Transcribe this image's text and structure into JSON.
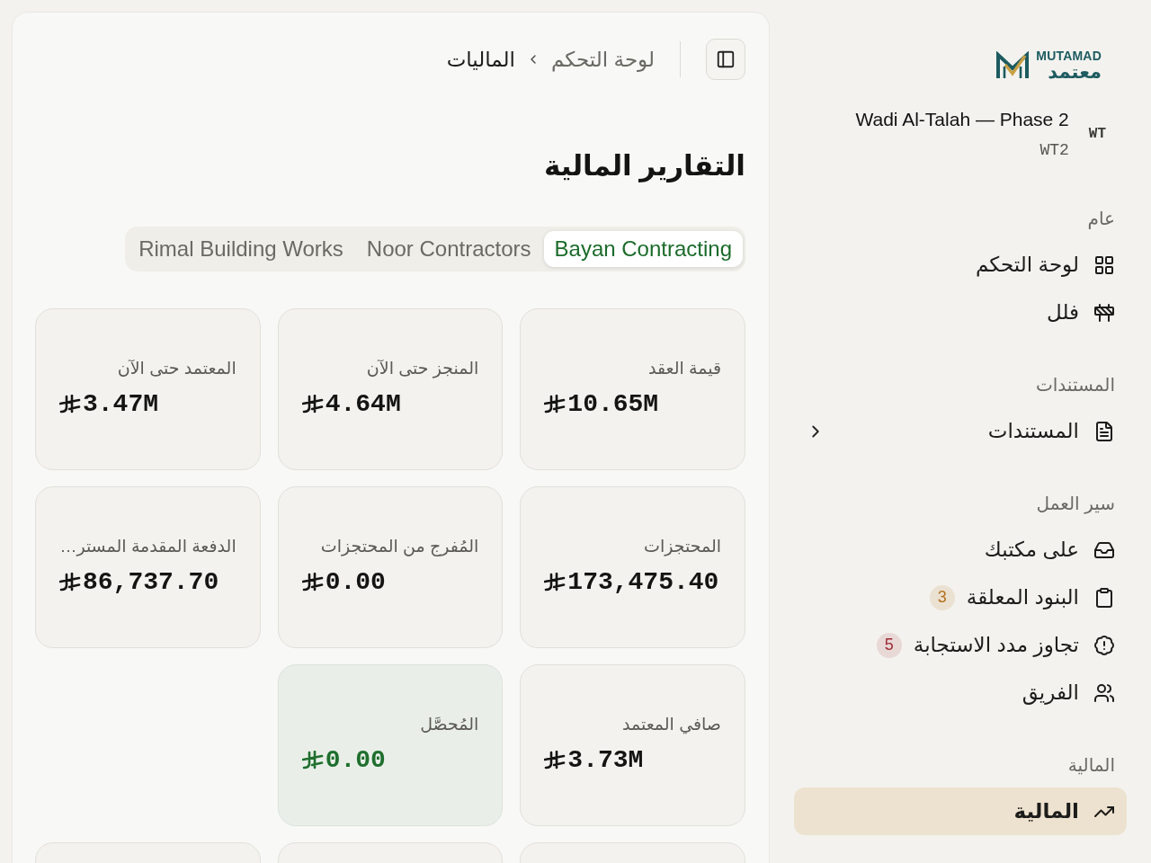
{
  "brand": {
    "name": "MUTAMAD",
    "name_ar": "معتمد"
  },
  "project": {
    "initials": "WT",
    "name": "Wadi Al-Talah — Phase 2",
    "code": "WT2"
  },
  "nav": [
    {
      "title": "عام",
      "items": [
        {
          "label": "لوحة التحكم",
          "selected": false
        },
        {
          "label": "فلل",
          "selected": false
        }
      ]
    },
    {
      "title": "المستندات",
      "items": [
        {
          "label": "المستندات",
          "selected": false,
          "expanded": false
        }
      ]
    },
    {
      "title": "سير العمل",
      "items": [
        {
          "label": "على مكتبك",
          "selected": false
        },
        {
          "label": "البنود المعلقة",
          "selected": false,
          "badge": {
            "text": "3",
            "color": "#b4701a"
          }
        },
        {
          "label": "تجاوز مدد الاستجابة",
          "selected": false,
          "badge": {
            "text": "5",
            "color": "#9c2b33"
          }
        },
        {
          "label": "الفريق",
          "selected": false
        }
      ]
    },
    {
      "title": "المالية",
      "items": [
        {
          "label": "المالية",
          "selected": true
        }
      ]
    }
  ],
  "breadcrumb": [
    {
      "label": "لوحة التحكم",
      "current": false
    },
    {
      "label": "الماليات",
      "current": true
    }
  ],
  "title": "التقارير المالية",
  "tabs": [
    {
      "label": "Bayan Contracting",
      "selected": true
    },
    {
      "label": "Noor Contractors",
      "selected": false
    },
    {
      "label": "Rimal Building Works",
      "selected": false
    }
  ],
  "stat_rows": [
    {
      "cards": [
        {
          "kind": "plain",
          "label": "قيمة العقد",
          "value": "10.65M"
        },
        {
          "kind": "plain",
          "label": "المنجز حتى الآن",
          "value": "4.64M"
        },
        {
          "kind": "plain",
          "label": "المعتمد حتى الآن",
          "value": "3.47M"
        }
      ]
    },
    {
      "cards": [
        {
          "kind": "plain",
          "label": "المحتجزات",
          "value": "173,475.40"
        },
        {
          "kind": "plain",
          "label": "المُفرج من المحتجزات",
          "value": "0.00"
        },
        {
          "kind": "plain",
          "label": "الدفعة المقدمة المستر…",
          "value": "86,737.70"
        }
      ]
    },
    {
      "cards": [
        {
          "kind": "plain",
          "label": "صافي المعتمد",
          "value": "3.73M"
        },
        {
          "kind": "positive",
          "label": "المُحصَّل",
          "value": "0.00"
        }
      ]
    },
    {
      "cards": [
        {
          "kind": "cut"
        },
        {
          "kind": "cut"
        },
        {
          "kind": "cut"
        }
      ]
    }
  ]
}
